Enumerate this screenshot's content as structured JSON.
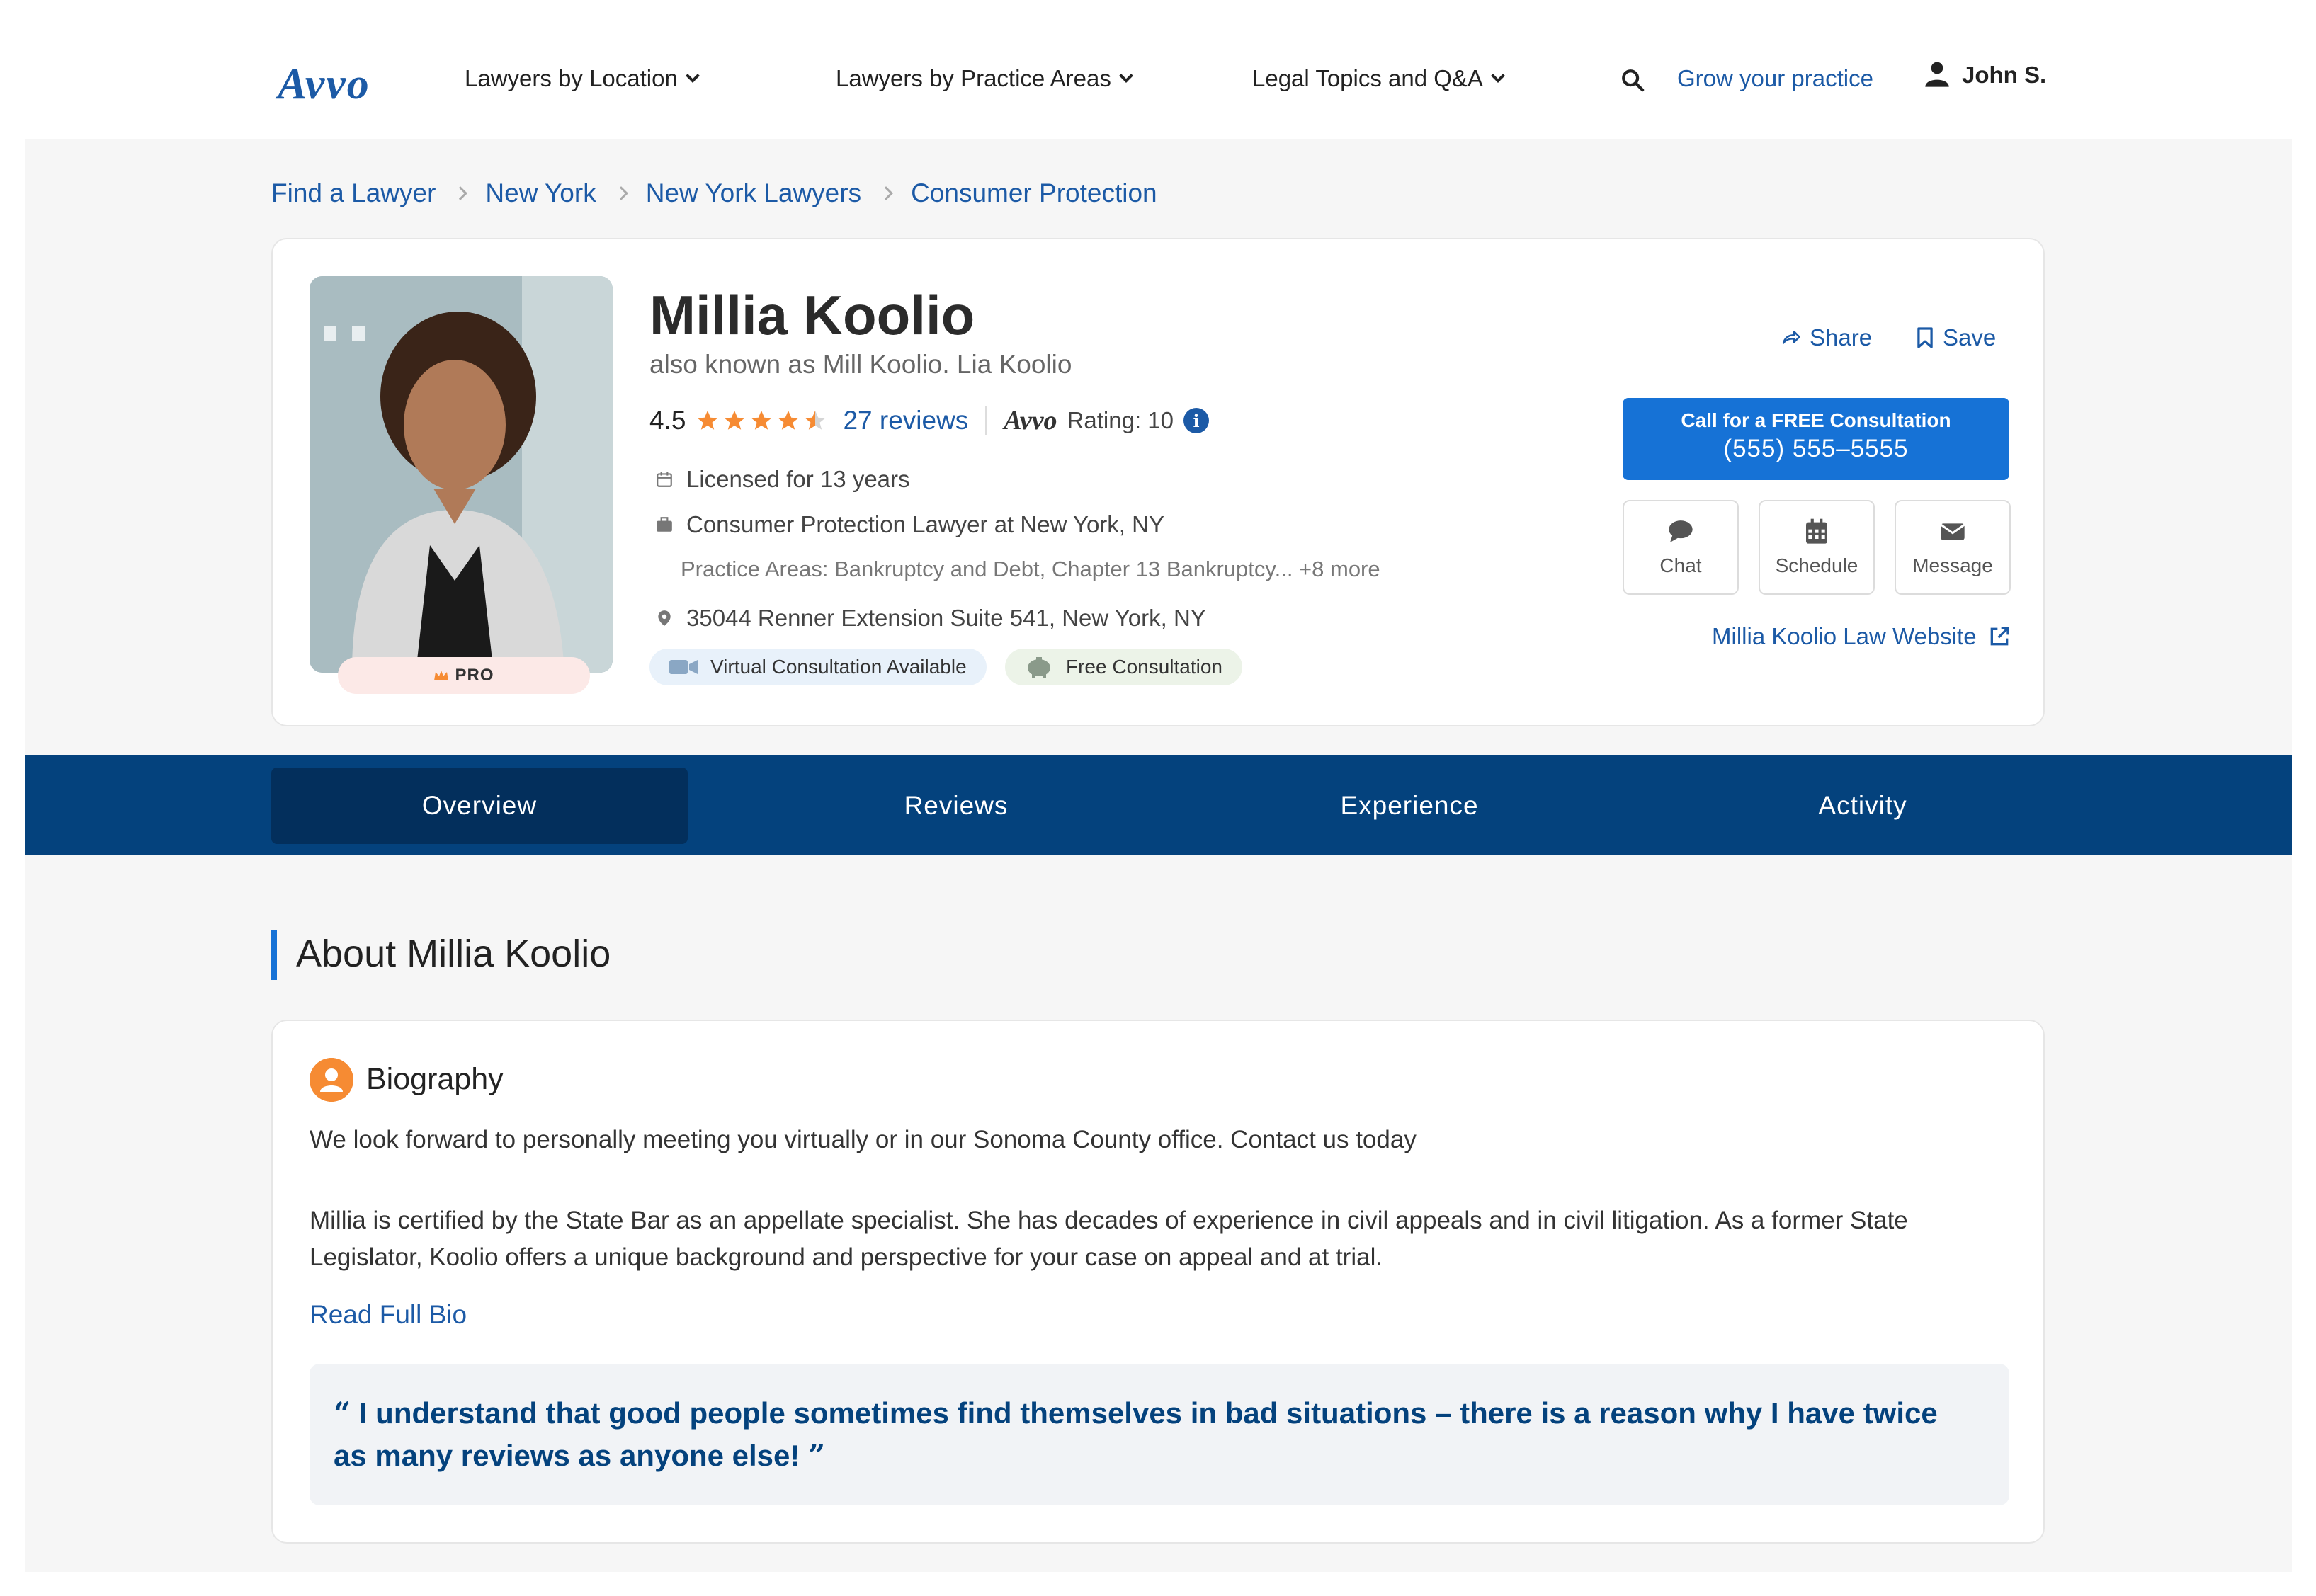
{
  "header": {
    "logo": "Avvo",
    "nav": [
      {
        "label": "Lawyers by Location"
      },
      {
        "label": "Lawyers by Practice Areas"
      },
      {
        "label": "Legal Topics and Q&A"
      }
    ],
    "grow_label": "Grow your practice",
    "user_name": "John S."
  },
  "breadcrumb": [
    "Find a Lawyer",
    "New York",
    "New York Lawyers",
    "Consumer Protection"
  ],
  "profile": {
    "pro_label": "PRO",
    "name": "Millia Koolio",
    "aka": "also known as Mill Koolio. Lia Koolio",
    "rating": "4.5",
    "stars": 4.5,
    "reviews_label": "27 reviews",
    "avvo_brand": "Avvo",
    "avvo_rating_label": "Rating: 10",
    "licensed": "Licensed for 13 years",
    "role": "Consumer Protection Lawyer at New York, NY",
    "practice_areas": "Practice Areas: Bankruptcy and Debt, Chapter 13 Bankruptcy... +8 more",
    "address": "35044 Renner Extension Suite 541, New York, NY",
    "pill_virtual": "Virtual Consultation Available",
    "pill_free": "Free Consultation",
    "share_label": "Share",
    "save_label": "Save",
    "call_line1": "Call for a FREE Consultation",
    "call_phone": "(555) 555–5555",
    "actions": [
      {
        "label": "Chat",
        "icon": "chat-icon"
      },
      {
        "label": "Schedule",
        "icon": "calendar-icon"
      },
      {
        "label": "Message",
        "icon": "envelope-icon"
      }
    ],
    "website_label": "Millia Koolio Law Website"
  },
  "tabs": [
    {
      "label": "Overview",
      "active": true
    },
    {
      "label": "Reviews"
    },
    {
      "label": "Experience"
    },
    {
      "label": "Activity"
    }
  ],
  "about": {
    "title": "About Millia Koolio",
    "bio_heading": "Biography",
    "p1": "We look forward to personally meeting you virtually or in our Sonoma County office. Contact us today",
    "p2": "Millia is certified by the State Bar as an appellate specialist. She has decades of experience in civil appeals and in civil litigation. As a former State Legislator, Koolio offers a unique background and perspective for your case on appeal and at trial.",
    "read_more": "Read Full Bio",
    "quote": "I understand that good people sometimes find themselves in bad situations – there is a reason why I have twice as many reviews as anyone else!"
  },
  "colors": {
    "brand_blue": "#1c5aa6",
    "cta_blue": "#1672d6",
    "tab_bar": "#04427d",
    "star": "#f68b33"
  }
}
